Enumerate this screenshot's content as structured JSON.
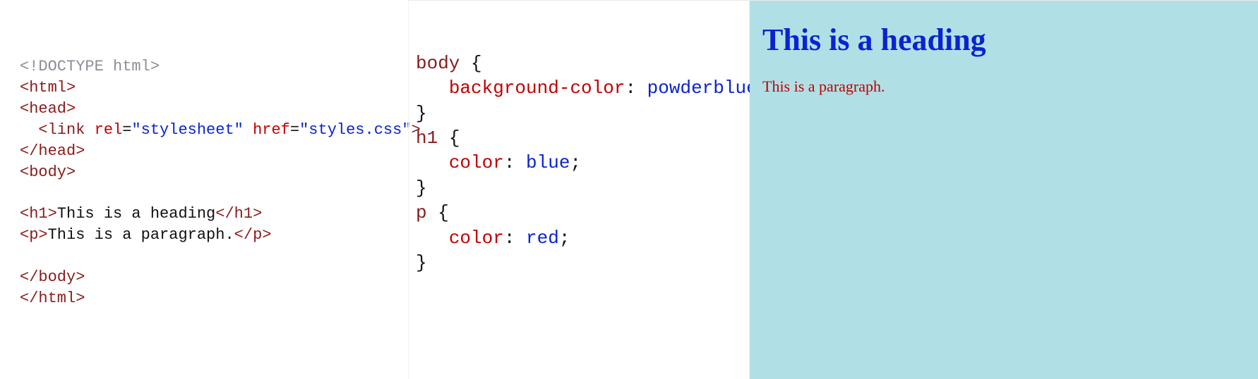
{
  "html_code": {
    "doctype": "<!DOCTYPE html>",
    "open_html": "html",
    "open_head": "head",
    "link_tag": "link",
    "link_attr_rel_name": "rel",
    "link_attr_rel_val": "\"stylesheet\"",
    "link_attr_href_name": "href",
    "link_attr_href_val": "\"styles.css\"",
    "close_head": "head",
    "open_body": "body",
    "h1_tag": "h1",
    "h1_text": "This is a heading",
    "p_tag": "p",
    "p_text": "This is a paragraph.",
    "close_body": "body",
    "close_html": "html"
  },
  "css_code": {
    "sel_body": "body",
    "prop_bg": "background-color",
    "val_bg": "powderblue",
    "sel_h1": "h1",
    "prop_color1": "color",
    "val_color1": "blue",
    "sel_p": "p",
    "prop_color2": "color",
    "val_color2": "red"
  },
  "preview": {
    "heading": "This is a heading",
    "paragraph": "This is a paragraph."
  },
  "colors": {
    "preview_bg": "#b0e0e6",
    "heading_color": "#0a23d1",
    "paragraph_color": "#c00000"
  }
}
